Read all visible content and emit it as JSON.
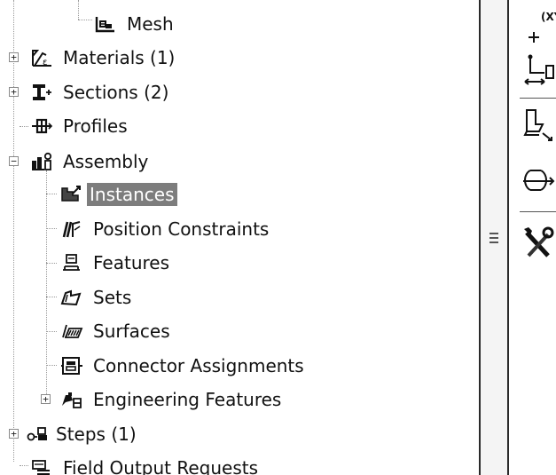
{
  "tree": {
    "items": [
      {
        "label": "Mesh",
        "icon": "mesh-icon",
        "expander": ""
      },
      {
        "label": "Materials (1)",
        "icon": "materials-icon",
        "expander": "+"
      },
      {
        "label": "Sections (2)",
        "icon": "sections-icon",
        "expander": "+"
      },
      {
        "label": "Profiles",
        "icon": "profiles-icon",
        "expander": ""
      },
      {
        "label": "Assembly",
        "icon": "assembly-icon",
        "expander": "−"
      },
      {
        "label": "Instances",
        "icon": "instances-icon",
        "expander": "",
        "selected": true
      },
      {
        "label": "Position Constraints",
        "icon": "position-constraints-icon",
        "expander": ""
      },
      {
        "label": "Features",
        "icon": "features-icon",
        "expander": ""
      },
      {
        "label": "Sets",
        "icon": "sets-icon",
        "expander": ""
      },
      {
        "label": "Surfaces",
        "icon": "surfaces-icon",
        "expander": ""
      },
      {
        "label": "Connector Assignments",
        "icon": "connector-assignments-icon",
        "expander": ""
      },
      {
        "label": "Engineering Features",
        "icon": "engineering-features-icon",
        "expander": "+"
      },
      {
        "label": "Steps (1)",
        "icon": "steps-icon",
        "expander": "+"
      },
      {
        "label": "Field Output Requests",
        "icon": "field-output-requests-icon",
        "expander": ""
      }
    ]
  },
  "toolbox": {
    "csys_label": "(XY,",
    "tools": [
      "datum-csys-icon",
      "datum-point-icon",
      "translate-instance-icon",
      "linear-pattern-icon",
      "tools-icon"
    ]
  },
  "colors": {
    "selection": "#7d7d7d",
    "splitter_border": "#2a2a2a"
  }
}
